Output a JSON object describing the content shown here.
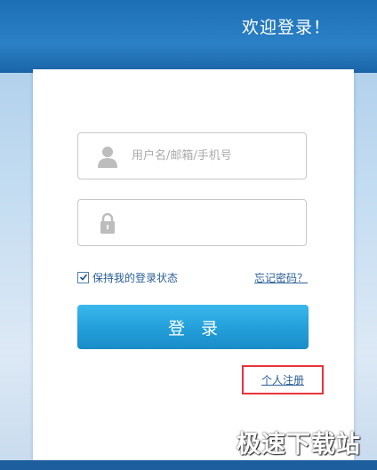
{
  "header": {
    "title": "欢迎登录！"
  },
  "form": {
    "username_placeholder": "用户名/邮箱/手机号",
    "username_value": "",
    "password_value": "",
    "remember_label": "保持我的登录状态",
    "remember_checked": true,
    "forgot_label": "忘记密码？",
    "login_label": "登录",
    "register_label": "个人注册"
  },
  "watermark": "极速下载站",
  "icons": {
    "username": "user-icon",
    "password": "lock-icon",
    "remember": "checkbox-checked-icon"
  },
  "colors": {
    "header": "#2b81c6",
    "button": "#24a0db",
    "link": "#2a5f96",
    "highlight": "#e8343c"
  }
}
